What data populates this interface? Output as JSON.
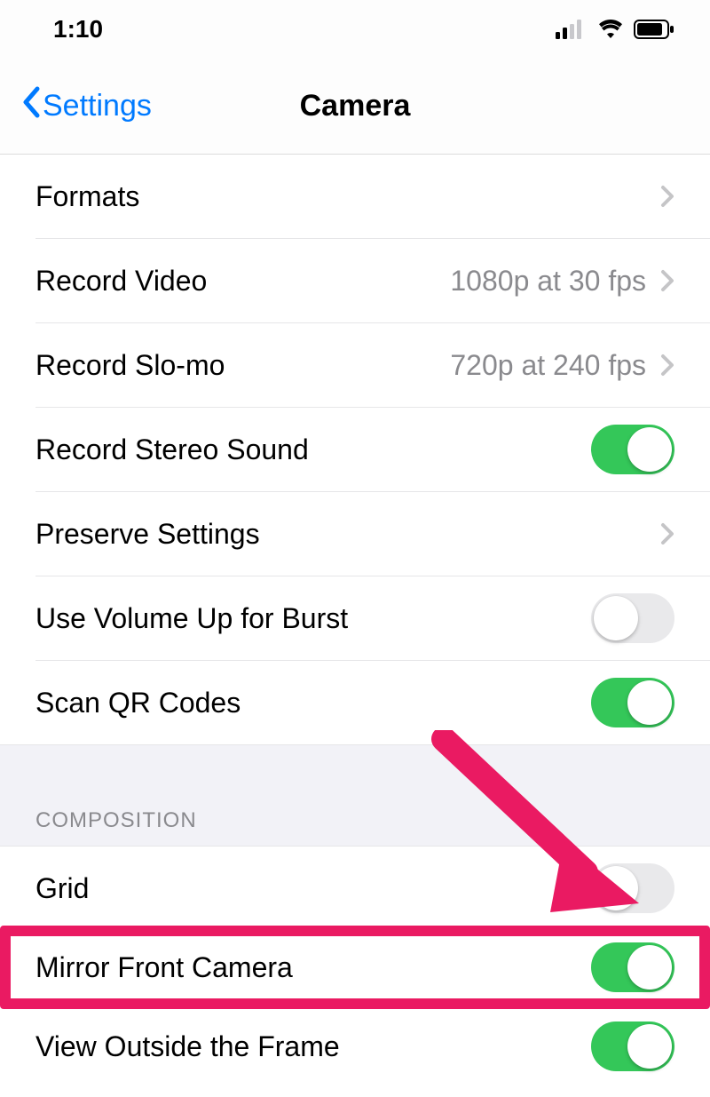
{
  "status": {
    "time": "1:10"
  },
  "nav": {
    "back_label": "Settings",
    "title": "Camera"
  },
  "section1": {
    "formats": {
      "label": "Formats"
    },
    "record_video": {
      "label": "Record Video",
      "value": "1080p at 30 fps"
    },
    "record_slomo": {
      "label": "Record Slo-mo",
      "value": "720p at 240 fps"
    },
    "stereo_sound": {
      "label": "Record Stereo Sound",
      "enabled": true
    },
    "preserve": {
      "label": "Preserve Settings"
    },
    "volume_burst": {
      "label": "Use Volume Up for Burst",
      "enabled": false
    },
    "scan_qr": {
      "label": "Scan QR Codes",
      "enabled": true
    }
  },
  "section2": {
    "header": "COMPOSITION",
    "grid": {
      "label": "Grid",
      "enabled": false
    },
    "mirror": {
      "label": "Mirror Front Camera",
      "enabled": true
    },
    "view_outside": {
      "label": "View Outside the Frame",
      "enabled": true
    }
  },
  "colors": {
    "accent": "#007aff",
    "toggle_on": "#34c759",
    "toggle_off": "#e9e9eb",
    "highlight": "#ea1a62"
  }
}
